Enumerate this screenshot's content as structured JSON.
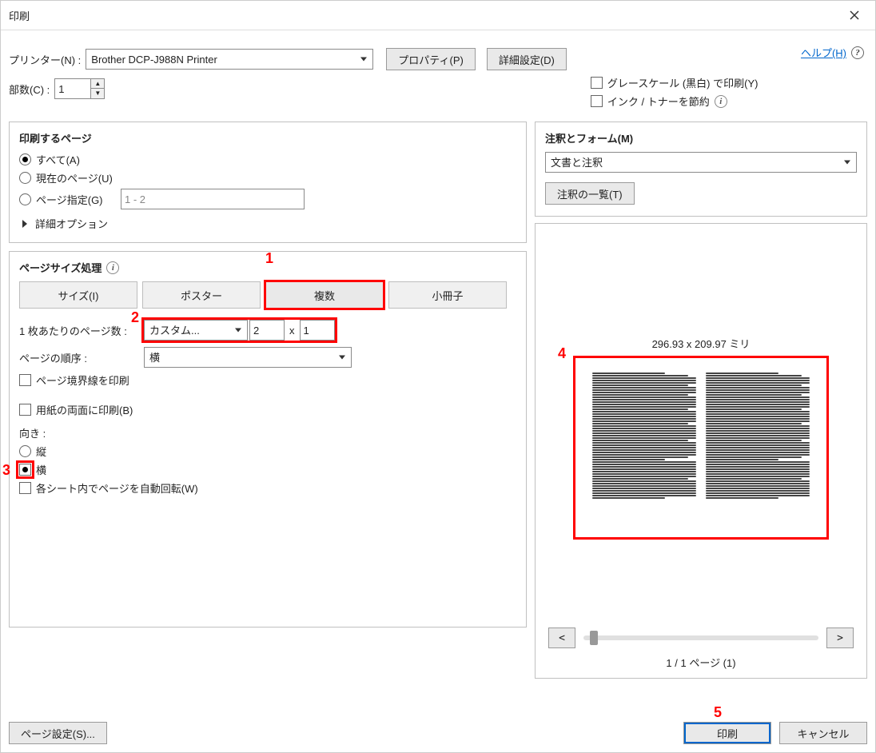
{
  "title": "印刷",
  "help": "ヘルプ(H)",
  "printer": {
    "label": "プリンター(N) :",
    "value": "Brother DCP-J988N Printer"
  },
  "properties_btn": "プロパティ(P)",
  "advanced_btn": "詳細設定(D)",
  "copies": {
    "label": "部数(C) :",
    "value": "1"
  },
  "grayscale": "グレースケール (黒白) で印刷(Y)",
  "savetoner": "インク / トナーを節約",
  "pages_section": "印刷するページ",
  "pages": {
    "all": "すべて(A)",
    "current": "現在のページ(U)",
    "range": "ページ指定(G)",
    "range_value": "1 - 2",
    "more": "詳細オプション"
  },
  "sizing_section": "ページサイズ処理",
  "tabs": {
    "size": "サイズ(I)",
    "poster": "ポスター",
    "multi": "複数",
    "booklet": "小冊子"
  },
  "per_sheet": {
    "label": "1 枚あたりのページ数 :",
    "select": "カスタム...",
    "w": "2",
    "x": "x",
    "h": "1"
  },
  "page_order": {
    "label": "ページの順序 :",
    "value": "横"
  },
  "print_border": "ページ境界線を印刷",
  "duplex": "用紙の両面に印刷(B)",
  "orient": {
    "label": "向き :",
    "portrait": "縦",
    "landscape": "横"
  },
  "auto_rotate": "各シート内でページを自動回転(W)",
  "comments_section": "注釈とフォーム(M)",
  "comments_select": "文書と注釈",
  "comments_btn": "注釈の一覧(T)",
  "preview_dim": "296.93 x 209.97 ミリ",
  "preview_nav": {
    "prev": "<",
    "next": ">"
  },
  "page_counter": "1 / 1 ページ (1)",
  "page_setup": "ページ設定(S)...",
  "print_btn": "印刷",
  "cancel_btn": "キャンセル",
  "callouts": {
    "c1": "1",
    "c2": "2",
    "c3": "3",
    "c4": "4",
    "c5": "5"
  }
}
